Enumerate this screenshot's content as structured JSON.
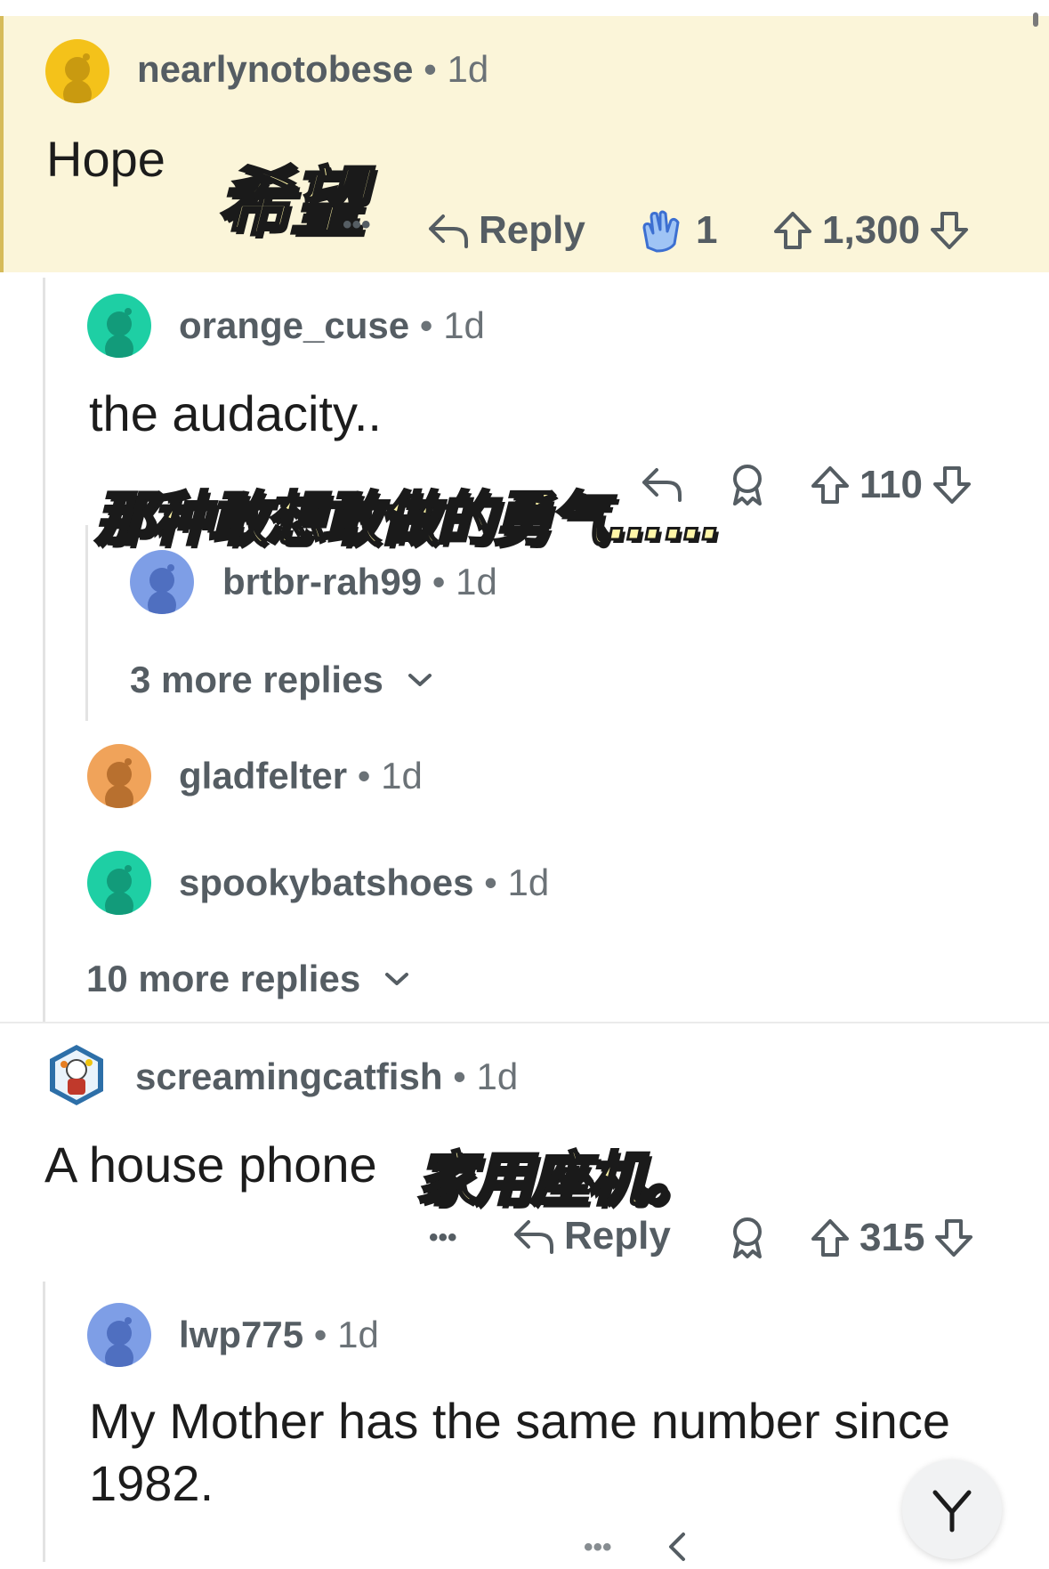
{
  "comments": [
    {
      "username": "nearlynotobese",
      "age": "1d",
      "avatar_color": "#f4c21a",
      "text": "Hope",
      "actions": {
        "more": "•••",
        "reply": "Reply",
        "award_count": "1",
        "votes": "1,300"
      }
    },
    {
      "username": "orange_cuse",
      "age": "1d",
      "avatar_color": "#1ecfa4",
      "text": "the audacity..",
      "actions": {
        "votes": "110"
      }
    },
    {
      "username": "brtbr-rah99",
      "age": "1d",
      "avatar_color": "#7e9ee6",
      "more_replies": "3 more replies"
    },
    {
      "username": "gladfelter",
      "age": "1d",
      "avatar_color": "#f0a35a"
    },
    {
      "username": "spookybatshoes",
      "age": "1d",
      "avatar_color": "#1ecfa4"
    },
    {
      "more_replies": "10 more replies"
    },
    {
      "username": "screamingcatfish",
      "age": "1d",
      "text": "A house phone",
      "actions": {
        "more": "•••",
        "reply": "Reply",
        "votes": "315"
      }
    },
    {
      "username": "lwp775",
      "age": "1d",
      "avatar_color": "#7e9ee6",
      "text_line1": "My Mother has the same number since",
      "text_line2": "1982."
    }
  ],
  "separator": "•",
  "overlays": {
    "hope": "希望",
    "audacity": "那种敢想敢做的勇气……",
    "house_phone": "家用座机。"
  },
  "colors": {
    "highlight_bg": "#fbf5d9",
    "overlay_text": "#fff6a8"
  }
}
